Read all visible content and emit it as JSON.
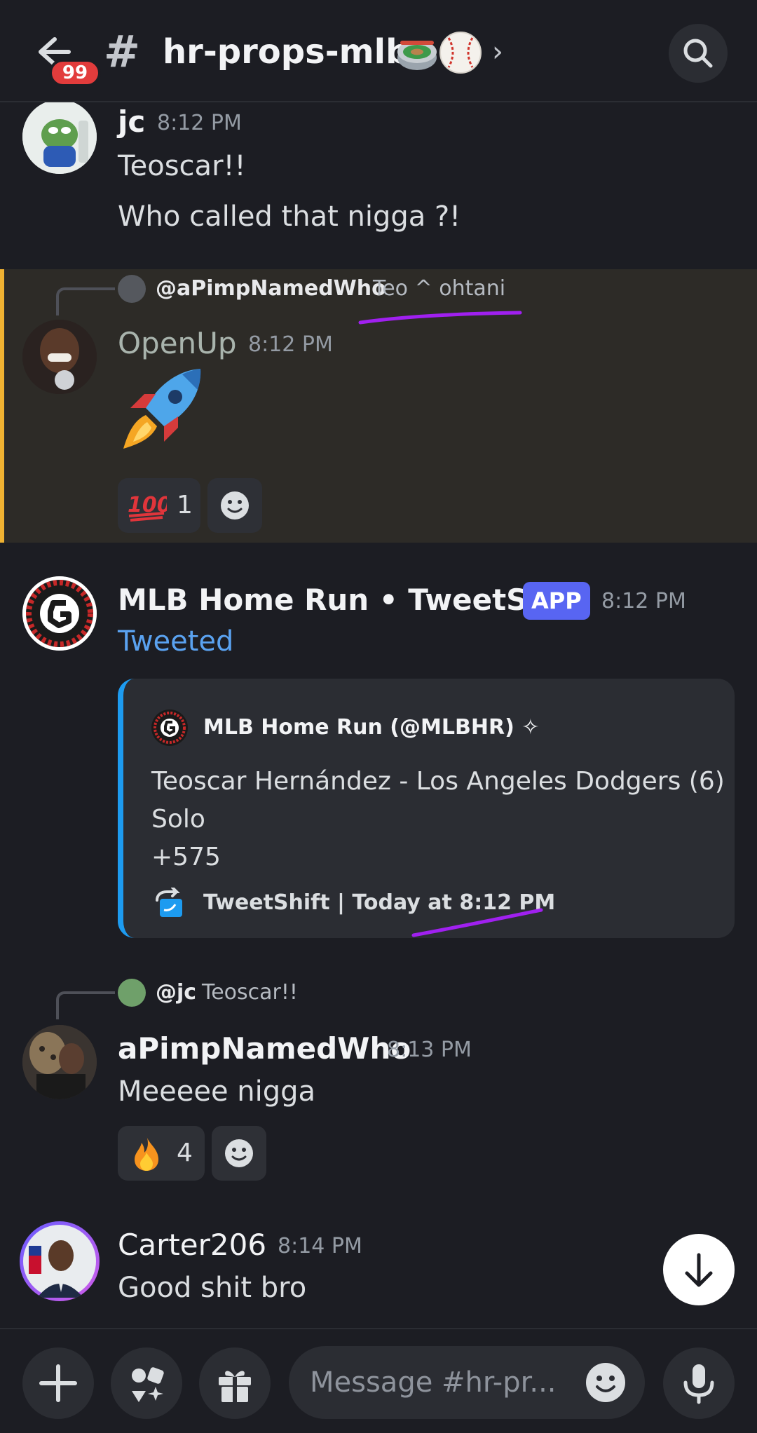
{
  "header": {
    "unread_badge": "99",
    "hash": "#",
    "channel_name": "hr-props-mlb-"
  },
  "messages": [
    {
      "username": "jc",
      "time": "8:12 PM",
      "lines": [
        "Teoscar!!",
        "Who called that nigga ?!"
      ]
    },
    {
      "reply": {
        "name": "@aPimpNamedWho",
        "text": "Teo ^ ohtani"
      },
      "username": "OpenUp",
      "time": "8:12 PM",
      "reactions": [
        {
          "count": "1"
        }
      ]
    },
    {
      "username": "MLB Home Run • TweetShift",
      "app_tag": "APP",
      "time": "8:12 PM",
      "action": "Tweeted",
      "embed": {
        "author": "MLB Home Run (@MLBHR) ✧",
        "description": [
          "Teoscar Hernández - Los Angeles Dodgers (6)",
          "Solo",
          "+575"
        ],
        "footer": "TweetShift | Today at 8:12 PM"
      }
    },
    {
      "reply": {
        "name": "@jc",
        "text": "Teoscar!!"
      },
      "username": "aPimpNamedWho",
      "time": "8:13 PM",
      "lines": [
        "Meeeee nigga"
      ],
      "reactions": [
        {
          "count": "4"
        }
      ]
    },
    {
      "username": "Carter206",
      "time": "8:14 PM",
      "lines": [
        "Good shit bro"
      ]
    }
  ],
  "composer": {
    "placeholder": "Message #hr-pr..."
  },
  "colors": {
    "background": "#1c1d23",
    "highlight_bar": "#f0b232",
    "app_tag": "#5865f2",
    "embed_accent": "#1d9bf0",
    "badge": "#e23c3c",
    "annotation": "#a020f0"
  }
}
